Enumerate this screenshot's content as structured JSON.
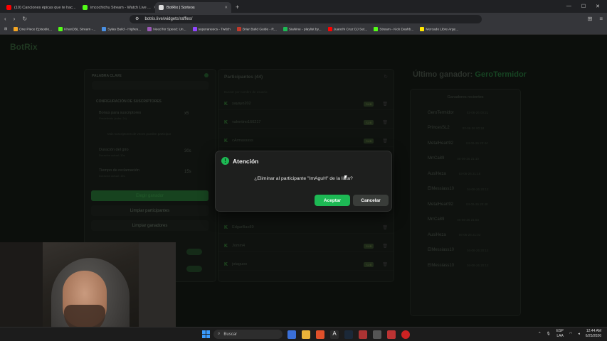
{
  "browser": {
    "tabs": [
      {
        "label": "(10) Canciones épicas que te hac...",
        "color": "#ff0000"
      },
      {
        "label": "imcochichu Stream - Watch Live ...",
        "color": "#53fc18"
      },
      {
        "label": "BotRix | Sorteos",
        "color": "#dddddd",
        "active": true
      }
    ],
    "url": "botrix.live/widgets/raffles/",
    "bookmarks": [
      {
        "label": "One Piece Episodio...",
        "color": "#f5a623"
      },
      {
        "label": "KhanDBL Stream -...",
        "color": "#53fc18"
      },
      {
        "label": "Sylas Build - Highes...",
        "color": "#4a90e2"
      },
      {
        "label": "Need for Speed: Un...",
        "color": "#9b59b6"
      },
      {
        "label": "superaneecs - Twitch",
        "color": "#9146ff"
      },
      {
        "label": "Briar Build Guide - R...",
        "color": "#c0392b"
      },
      {
        "label": "SiaNine - playlist by...",
        "color": "#1db954"
      },
      {
        "label": "Juanchi Cruz DJ Set...",
        "color": "#ff0000"
      },
      {
        "label": "Stream - Kick Dashb...",
        "color": "#53fc18"
      },
      {
        "label": "Mercado Libre Arge...",
        "color": "#ffe600"
      }
    ]
  },
  "app": {
    "logo": "BotRix",
    "left_panel": {
      "keyword_label": "PALABRA CLAVE",
      "subscribers_label": "CONFIGURACIÓN DE SUSCRIPTORES",
      "bonus_label": "Bonus para suscriptores",
      "bonus_sub": "Predefinido (subs: 2x)",
      "bonus_value": "x5",
      "note": "Más suscriptores de veces pueden participar",
      "spin_label": "Duración del giro",
      "spin_sub": "Duración actual: 10s",
      "spin_value": "30s",
      "reclaim_label": "Tiempo de reclamación",
      "reclaim_sub": "Duración actual: 15s",
      "reclaim_value": "15s",
      "btn_pick": "Elegir ganador",
      "btn_clear_participants": "Limpiar participantes",
      "btn_clear_winners": "Limpiar ganadores"
    },
    "participants": {
      "title": "Participantes (44)",
      "search_placeholder": "Buscar por nombre de usuario",
      "rows": [
        {
          "name": "yayayo202",
          "badge": "SUB"
        },
        {
          "name": "valentino160217",
          "badge": "SUB"
        },
        {
          "name": "cArmasssss",
          "badge": "SUB"
        },
        {
          "name": "Ocosiddduuu",
          "badge": "SUB"
        },
        {
          "name": "EdgarBao89",
          "badge": ""
        },
        {
          "name": "Jomm4",
          "badge": "SUB"
        },
        {
          "name": "jotaguoo",
          "badge": "SUB"
        }
      ]
    },
    "winners": {
      "title_prefix": "Último ganador:",
      "title_name": "GeroTermidor",
      "recent_label": "Ganadores recientes",
      "rows": [
        {
          "name": "GeroTermidor",
          "date": "02-06-26 00:21"
        },
        {
          "name": "PrincesSL2",
          "date": "03-06-26 00:18"
        },
        {
          "name": "MetalHeart92",
          "date": "04-06-26 23:44"
        },
        {
          "name": "MrrCa89",
          "date": "06-06-26 21:10"
        },
        {
          "name": "AusiHeza",
          "date": "03-06-26 21:15"
        },
        {
          "name": "ElMessiass10",
          "date": "04-06-26 20:12"
        },
        {
          "name": "MetalHeart92",
          "date": "04-06-26 20:48"
        },
        {
          "name": "MrrCa89",
          "date": "06-06-26 21:03"
        },
        {
          "name": "AusiHeza",
          "date": "06-06-26 21:03"
        },
        {
          "name": "ElMessiass10",
          "date": "04-06-26 20:12"
        },
        {
          "name": "ElMessiass10",
          "date": "04-06-26 20:12"
        }
      ]
    }
  },
  "modal": {
    "title": "Atención",
    "message": "¿Eliminar al participante \"ImAguH\" de la lista?",
    "accept": "Aceptar",
    "cancel": "Cancelar"
  },
  "taskbar": {
    "search_placeholder": "Buscar",
    "lang": "ESP",
    "lang2": "LAA",
    "time": "12:44 AM",
    "date": "6/25/2026"
  },
  "colors": {
    "accent": "#1db954",
    "kick": "#53fc18"
  }
}
